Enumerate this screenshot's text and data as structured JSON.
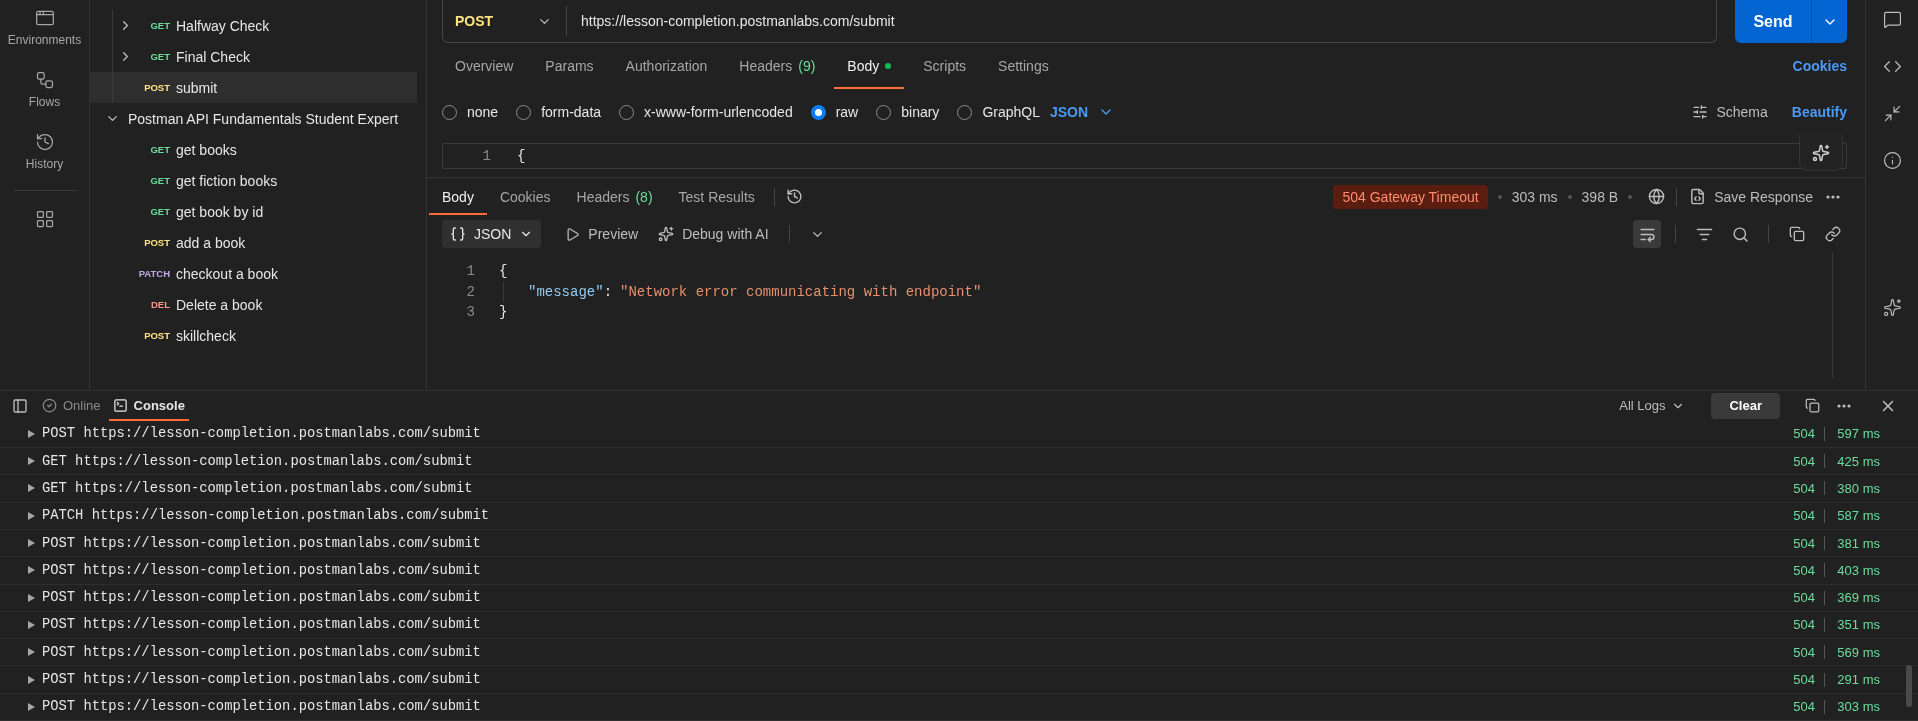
{
  "rail": [
    {
      "label": "Environments",
      "kind": "environments"
    },
    {
      "label": "Flows",
      "kind": "flows"
    },
    {
      "label": "History",
      "kind": "history"
    }
  ],
  "tree": [
    {
      "kind": "request",
      "method": "GET",
      "color": "#6bdd9a",
      "name": "Halfway Check",
      "expanded": false,
      "selected": false
    },
    {
      "kind": "request",
      "method": "GET",
      "color": "#6bdd9a",
      "name": "Final Check",
      "expanded": false,
      "selected": false
    },
    {
      "kind": "request",
      "method": "POST",
      "color": "#ffe47e",
      "name": "submit",
      "selected": true
    },
    {
      "kind": "folder",
      "name": "Postman API Fundamentals Student Expert",
      "expanded": true,
      "selected": false,
      "children": [
        {
          "kind": "request",
          "method": "GET",
          "color": "#6bdd9a",
          "name": "get books",
          "selected": false
        },
        {
          "kind": "request",
          "method": "GET",
          "color": "#6bdd9a",
          "name": "get fiction books",
          "selected": false
        },
        {
          "kind": "request",
          "method": "GET",
          "color": "#6bdd9a",
          "name": "get book by id",
          "selected": false
        },
        {
          "kind": "request",
          "method": "POST",
          "color": "#ffe47e",
          "name": "add a book",
          "selected": false
        },
        {
          "kind": "request",
          "method": "PATCH",
          "color": "#c0a8e1",
          "name": "checkout a book",
          "selected": false
        },
        {
          "kind": "request",
          "method": "DEL",
          "color": "#f79a8e",
          "name": "Delete a book",
          "selected": false
        },
        {
          "kind": "request",
          "method": "POST",
          "color": "#ffe47e",
          "name": "skillcheck",
          "selected": false
        }
      ]
    }
  ],
  "request": {
    "method": "POST",
    "url": "https://lesson-completion.postmanlabs.com/submit",
    "send": "Send"
  },
  "request_tabs": [
    {
      "label": "Overview",
      "selected": false
    },
    {
      "label": "Params",
      "selected": false
    },
    {
      "label": "Authorization",
      "selected": false
    },
    {
      "label": "Headers",
      "count": "(9)",
      "selected": false
    },
    {
      "label": "Body",
      "dot": true,
      "selected": true
    },
    {
      "label": "Scripts",
      "selected": false
    },
    {
      "label": "Settings",
      "selected": false
    }
  ],
  "cookies_link": "Cookies",
  "body_types": [
    {
      "label": "none",
      "selected": false
    },
    {
      "label": "form-data",
      "selected": false
    },
    {
      "label": "x-www-form-urlencoded",
      "selected": false
    },
    {
      "label": "raw",
      "selected": true
    },
    {
      "label": "binary",
      "selected": false
    },
    {
      "label": "GraphQL",
      "selected": false
    }
  ],
  "raw_format": "JSON",
  "schema": "Schema",
  "beautify": "Beautify",
  "request_body": [
    {
      "number": "1",
      "text": "{"
    }
  ],
  "response_tabs": [
    {
      "label": "Body",
      "selected": true
    },
    {
      "label": "Cookies",
      "selected": false
    },
    {
      "label": "Headers",
      "count": "(8)",
      "selected": false
    },
    {
      "label": "Test Results",
      "selected": false
    }
  ],
  "response_meta": {
    "status": "504 Gateway Timeout",
    "time": "303 ms",
    "size": "398 B",
    "save": "Save Response"
  },
  "response_toolbar": {
    "format": "JSON",
    "preview": "Preview",
    "debug": "Debug with AI",
    "wrap_on": true
  },
  "response_body": [
    {
      "number": "1",
      "tokens": [
        {
          "kind": "punct",
          "text": "{"
        }
      ]
    },
    {
      "number": "2",
      "indent": true,
      "tokens": [
        {
          "kind": "key",
          "text": "\"message\""
        },
        {
          "kind": "punct",
          "text": ":"
        },
        {
          "kind": "string",
          "text": "\"Network error communicating with endpoint\""
        }
      ]
    },
    {
      "number": "3",
      "tokens": [
        {
          "kind": "punct",
          "text": "}"
        }
      ]
    }
  ],
  "console_tabs": [
    {
      "label": "Online",
      "kind": "online",
      "selected": false
    },
    {
      "label": "Console",
      "kind": "console",
      "selected": true
    }
  ],
  "console_filter": "All Logs",
  "console_clear": "Clear",
  "console_rows": [
    {
      "line": "POST https://lesson-completion.postmanlabs.com/submit",
      "status": "504",
      "time": "597 ms"
    },
    {
      "line": "GET https://lesson-completion.postmanlabs.com/submit",
      "status": "504",
      "time": "425 ms"
    },
    {
      "line": "GET https://lesson-completion.postmanlabs.com/submit",
      "status": "504",
      "time": "380 ms"
    },
    {
      "line": "PATCH https://lesson-completion.postmanlabs.com/submit",
      "status": "504",
      "time": "587 ms"
    },
    {
      "line": "POST https://lesson-completion.postmanlabs.com/submit",
      "status": "504",
      "time": "381 ms"
    },
    {
      "line": "POST https://lesson-completion.postmanlabs.com/submit",
      "status": "504",
      "time": "403 ms"
    },
    {
      "line": "POST https://lesson-completion.postmanlabs.com/submit",
      "status": "504",
      "time": "369 ms"
    },
    {
      "line": "POST https://lesson-completion.postmanlabs.com/submit",
      "status": "504",
      "time": "351 ms"
    },
    {
      "line": "POST https://lesson-completion.postmanlabs.com/submit",
      "status": "504",
      "time": "569 ms"
    },
    {
      "line": "POST https://lesson-completion.postmanlabs.com/submit",
      "status": "504",
      "time": "291 ms"
    },
    {
      "line": "POST https://lesson-completion.postmanlabs.com/submit",
      "status": "504",
      "time": "303 ms"
    }
  ]
}
